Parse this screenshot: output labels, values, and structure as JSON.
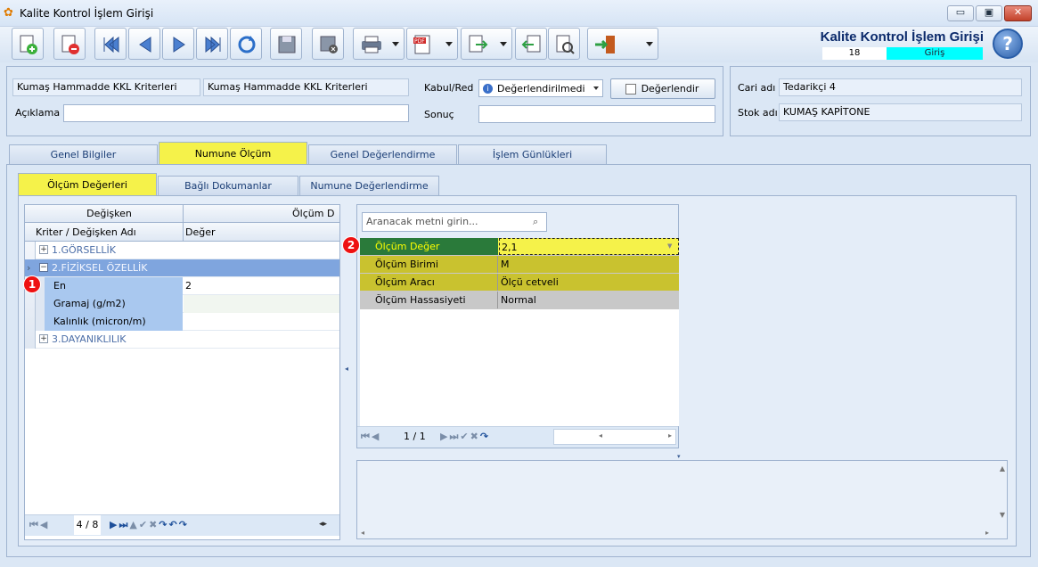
{
  "window": {
    "title": "Kalite Kontrol İşlem Girişi",
    "min": "▭",
    "max": "▣",
    "close": "✕"
  },
  "toolbar": {
    "buttons": [
      "new-icon",
      "delete-icon",
      "first-icon",
      "prev-icon",
      "next-icon",
      "last-icon",
      "refresh-icon",
      "save-icon",
      "cancel-icon",
      "print-icon",
      "pdf-icon",
      "export-icon",
      "import-icon",
      "tools-icon",
      "exit-icon"
    ]
  },
  "header": {
    "title": "Kalite Kontrol İşlem Girişi",
    "number": "18",
    "type": "Giriş",
    "help": "?"
  },
  "form": {
    "kriter1": "Kumaş Hammadde KKL Kriterleri",
    "kriter2": "Kumaş Hammadde KKL Kriterleri",
    "aciklama_label": "Açıklama",
    "aciklama_value": "",
    "kabul_label": "Kabul/Red",
    "kabul_value": "Değerlendirilmedi",
    "degerlendir_label": "Değerlendir",
    "sonuc_label": "Sonuç",
    "sonuc_value": "",
    "cari_label": "Cari adı",
    "cari_value": "Tedarikçi 4",
    "stok_label": "Stok adı",
    "stok_value": "KUMAŞ KAPİTONE"
  },
  "tabs": [
    {
      "label": "Genel Bilgiler"
    },
    {
      "label": "Numune Ölçüm"
    },
    {
      "label": "Genel Değerlendirme"
    },
    {
      "label": "İşlem Günlükleri"
    }
  ],
  "subtabs": [
    {
      "label": "Ölçüm Değerleri"
    },
    {
      "label": "Bağlı Dokumanlar"
    },
    {
      "label": "Numune Değerlendirme"
    }
  ],
  "grid": {
    "band1": "Değişken",
    "band2": "Ölçüm D",
    "col1": "Kriter / Değişken Adı",
    "col2": "Değer",
    "rows": [
      {
        "name": "1.GÖRSELLİK",
        "value": "",
        "group": true,
        "sign": "+"
      },
      {
        "name": "2.FİZİKSEL ÖZELLİK",
        "value": "",
        "group": true,
        "sign": "−"
      },
      {
        "name": "En",
        "value": "2",
        "group": false
      },
      {
        "name": "Gramaj (g/m2)",
        "value": "",
        "group": false
      },
      {
        "name": "Kalınlık (micron/m)",
        "value": "",
        "group": false
      },
      {
        "name": "3.DAYANIKLILIK",
        "value": "",
        "group": true,
        "sign": "+"
      }
    ],
    "nav_position": "4 / 8"
  },
  "props": {
    "search_placeholder": "Aranacak metni girin...",
    "rows": [
      {
        "label": "Ölçüm Değer",
        "value": "2,1"
      },
      {
        "label": "Ölçüm Birimi",
        "value": "M"
      },
      {
        "label": "Ölçüm Aracı",
        "value": "Ölçü cetveli"
      },
      {
        "label": "Ölçüm Hassasiyeti",
        "value": "Normal"
      }
    ],
    "nav_position": "1 / 1"
  },
  "badges": {
    "one": "1",
    "two": "2"
  },
  "colors": {
    "highlight_yellow": "#f5f24a",
    "giris_cyan": "#00ffff",
    "olive": "#c9c22f",
    "selected_blue": "#7fa5de"
  }
}
